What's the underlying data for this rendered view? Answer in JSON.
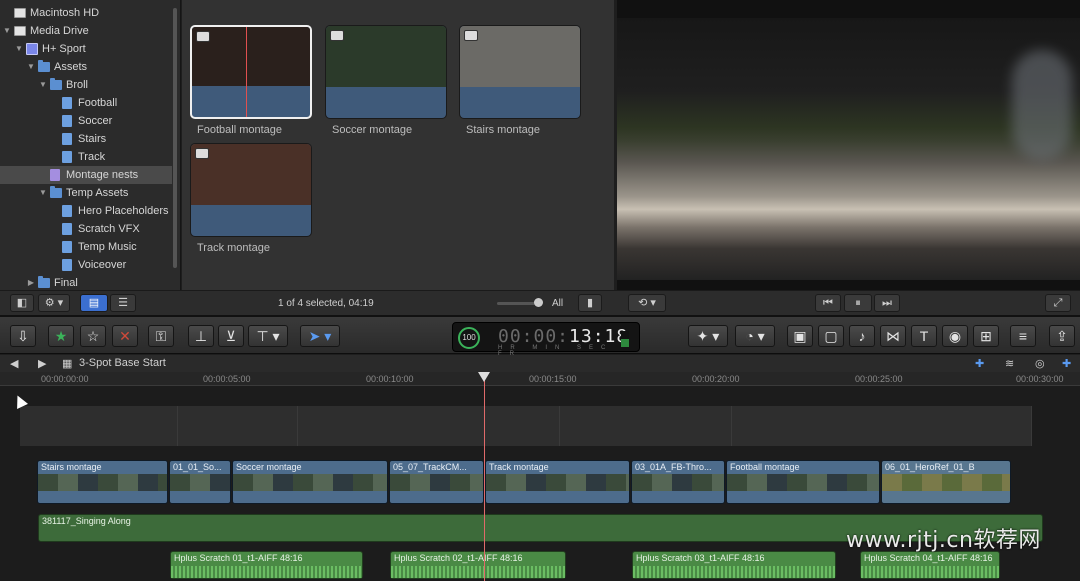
{
  "library": {
    "items": [
      {
        "label": "Macintosh HD",
        "icon": "disk-icon",
        "indent": 0,
        "expanded": null,
        "selected": false
      },
      {
        "label": "Media Drive",
        "icon": "disk-icon",
        "indent": 0,
        "expanded": true,
        "selected": false
      },
      {
        "label": "H+ Sport",
        "icon": "library-icon",
        "indent": 1,
        "expanded": true,
        "selected": false
      },
      {
        "label": "Assets",
        "icon": "folder-icon",
        "indent": 2,
        "expanded": true,
        "selected": false
      },
      {
        "label": "Broll",
        "icon": "folder-icon",
        "indent": 3,
        "expanded": true,
        "selected": false
      },
      {
        "label": "Football",
        "icon": "event-icon",
        "indent": 4,
        "expanded": null,
        "selected": false
      },
      {
        "label": "Soccer",
        "icon": "event-icon",
        "indent": 4,
        "expanded": null,
        "selected": false
      },
      {
        "label": "Stairs",
        "icon": "event-icon",
        "indent": 4,
        "expanded": null,
        "selected": false
      },
      {
        "label": "Track",
        "icon": "event-icon",
        "indent": 4,
        "expanded": null,
        "selected": false
      },
      {
        "label": "Montage nests",
        "icon": "nest-icon",
        "indent": 3,
        "expanded": null,
        "selected": true
      },
      {
        "label": "Temp Assets",
        "icon": "folder-icon",
        "indent": 3,
        "expanded": true,
        "selected": false
      },
      {
        "label": "Hero Placeholders",
        "icon": "event-icon",
        "indent": 4,
        "expanded": null,
        "selected": false
      },
      {
        "label": "Scratch VFX",
        "icon": "event-icon",
        "indent": 4,
        "expanded": null,
        "selected": false
      },
      {
        "label": "Temp Music",
        "icon": "event-icon",
        "indent": 4,
        "expanded": null,
        "selected": false
      },
      {
        "label": "Voiceover",
        "icon": "event-icon",
        "indent": 4,
        "expanded": null,
        "selected": false
      },
      {
        "label": "Final",
        "icon": "folder-icon",
        "indent": 2,
        "expanded": false,
        "selected": false
      }
    ]
  },
  "browser": {
    "clips": [
      {
        "label": "Football montage",
        "selected": true,
        "thumb": "#2a201c"
      },
      {
        "label": "Soccer montage",
        "selected": false,
        "thumb": "#2b3a2a"
      },
      {
        "label": "Stairs montage",
        "selected": false,
        "thumb": "#6b6a66"
      },
      {
        "label": "Track montage",
        "selected": false,
        "thumb": "#4a3027"
      }
    ],
    "status": "1 of 4 selected, 04:19",
    "filter_label": "All"
  },
  "timecode": {
    "prefix": "00:00:",
    "value": "13:18",
    "units": "HR MIN SEC FR",
    "percent": "100"
  },
  "timeline": {
    "project_name": "3-Spot Base Start",
    "ruler": [
      "00:00:00:00",
      "00:00:05:00",
      "00:00:10:00",
      "00:00:15:00",
      "00:00:20:00",
      "00:00:25:00",
      "00:00:30:00"
    ],
    "video_clips": [
      {
        "label": "Stairs montage"
      },
      {
        "label": "01_01_So..."
      },
      {
        "label": "Soccer montage"
      },
      {
        "label": "05_07_TrackCM..."
      },
      {
        "label": "Track montage"
      },
      {
        "label": "03_01A_FB-Thro..."
      },
      {
        "label": "Football montage"
      },
      {
        "label": "06_01_HeroRef_01_B"
      }
    ],
    "music_clip": "381117_Singing Along",
    "scratch_clips": [
      {
        "label": "Hplus Scratch 01_t1-AIFF 48:16"
      },
      {
        "label": "Hplus Scratch 02_t1-AIFF 48:16"
      },
      {
        "label": "Hplus Scratch 03_t1-AIFF 48:16"
      },
      {
        "label": "Hplus Scratch 04_t1-AIFF 48:16"
      }
    ]
  },
  "watermark": "www.rjtj.cn软荐网"
}
